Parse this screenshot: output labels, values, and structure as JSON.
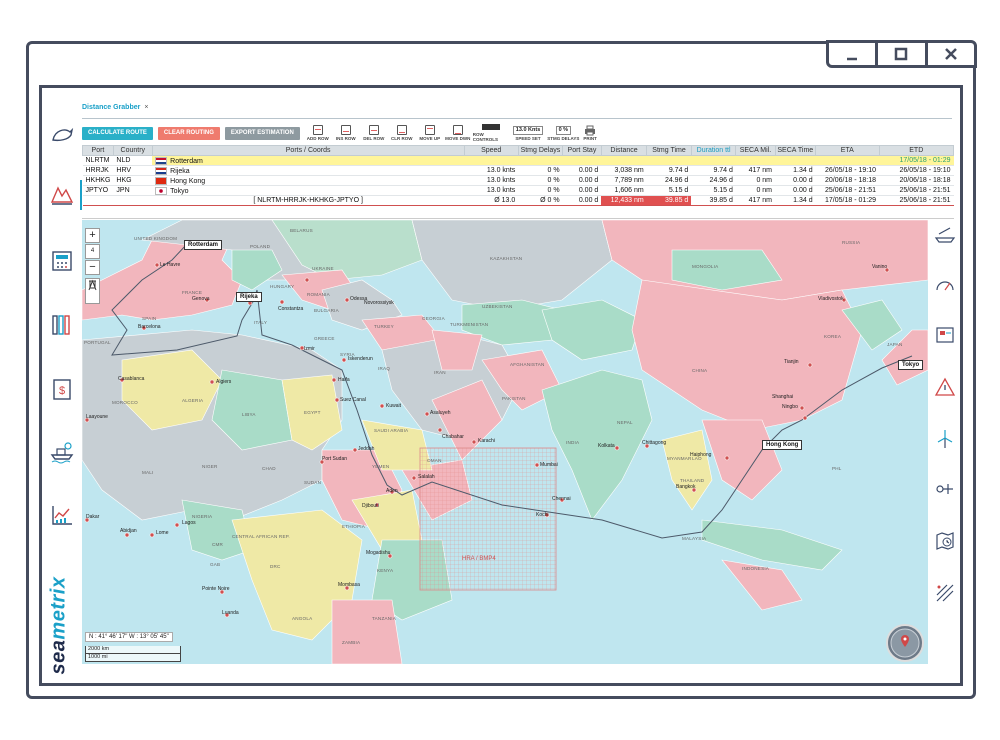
{
  "window": {
    "min_icon": "minimize-icon",
    "max_icon": "maximize-icon",
    "close_icon": "close-icon"
  },
  "tab": {
    "label": "Distance Grabber",
    "close": "×"
  },
  "toolbar": {
    "calculate": "CALCULATE ROUTE",
    "clear": "CLEAR ROUTING",
    "export": "EXPORT ESTIMATION",
    "icons": [
      "ADD ROW",
      "INS ROW",
      "DEL ROW",
      "CLR ROW",
      "MOVE UP",
      "MOVE DWN"
    ],
    "row_controls": "ROW CONTROLS",
    "speed_value": "13.0 Knts",
    "speed_label": "SPEED SET",
    "delays_value": "0 %",
    "delays_label": "STMG DELAYS",
    "print_label": "PRINT"
  },
  "table": {
    "headers": [
      "Port",
      "Country",
      "Ports / Coords",
      "Speed",
      "Stmg Delays",
      "Port Stay",
      "Distance",
      "Stmg Time",
      "Duration ttl",
      "SECA Mil.",
      "SECA Time",
      "ETA",
      "ETD"
    ],
    "rows": [
      {
        "port": "NLRTM",
        "country": "NLD",
        "name": "Rotterdam",
        "speed": "",
        "delays": "",
        "stay": "",
        "distance": "",
        "stmg": "",
        "duration": "",
        "seca": "",
        "secat": "",
        "eta": "",
        "etd": "17/05/18 - 01:29"
      },
      {
        "port": "HRRJK",
        "country": "HRV",
        "name": "Rijeka",
        "speed": "13.0 knts",
        "delays": "0 %",
        "stay": "0.00 d",
        "distance": "3,038 nm",
        "stmg": "9.74 d",
        "duration": "9.74 d",
        "seca": "417 nm",
        "secat": "1.34 d",
        "eta": "26/05/18 - 19:10",
        "etd": "26/05/18 - 19:10"
      },
      {
        "port": "HKHKG",
        "country": "HKG",
        "name": "Hong Kong",
        "speed": "13.0 knts",
        "delays": "0 %",
        "stay": "0.00 d",
        "distance": "7,789 nm",
        "stmg": "24.96 d",
        "duration": "24.96 d",
        "seca": "0 nm",
        "secat": "0.00 d",
        "eta": "20/06/18 - 18:18",
        "etd": "20/06/18 - 18:18"
      },
      {
        "port": "JPTYO",
        "country": "JPN",
        "name": "Tokyo",
        "speed": "13.0 knts",
        "delays": "0 %",
        "stay": "0.00 d",
        "distance": "1,606 nm",
        "stmg": "5.15 d",
        "duration": "5.15 d",
        "seca": "0 nm",
        "secat": "0.00 d",
        "eta": "25/06/18 - 21:51",
        "etd": "25/06/18 - 21:51"
      }
    ],
    "summary": {
      "route": "[ NLRTM-HRRJK-HKHKG-JPTYO ]",
      "speed": "Ø 13.0",
      "delays": "Ø 0 %",
      "stay": "0.00 d",
      "distance": "12,433 nm",
      "stmg": "39.85 d",
      "duration": "39.85 d",
      "seca": "417 nm",
      "secat": "1.34 d",
      "eta": "17/05/18 - 01:29",
      "etd": "25/06/18 - 21:51"
    }
  },
  "map": {
    "zoom_in": "+",
    "zoom_level": "4",
    "zoom_out": "−",
    "coords": "N : 41° 46' 17\"  W : 13° 05' 45\"",
    "scale_km": "2000 km",
    "scale_mi": "1000 mi",
    "hra": "HRA / BMP4",
    "port_labels": [
      "Rotterdam",
      "Rijeka",
      "Hong Kong",
      "Tokyo"
    ],
    "cities": [
      "Le Havre",
      "Genova",
      "Rijeka",
      "Odessa",
      "Novorossiysk",
      "Constantza",
      "Barcelona",
      "Izmir",
      "Iskenderun",
      "Haifa",
      "Suez Canal",
      "Algiers",
      "Casablanca",
      "Kuwait",
      "Asaluyeh",
      "Chabahar",
      "Karachi",
      "Jeddah",
      "Port Sudan",
      "Salalah",
      "Aden",
      "Djibouti",
      "Mumbai",
      "Kolkata",
      "Chittagong",
      "Chennai",
      "Kochi",
      "Haiphong",
      "Bangkok",
      "Shanghai",
      "Ningbo",
      "Tianjin",
      "Vladivostok",
      "Vanino",
      "Mogadishu",
      "Mombasa",
      "Lagos",
      "Abidjan",
      "Lome",
      "Pointe Noire",
      "Luanda",
      "Dakar",
      "Laayoune"
    ],
    "countries": [
      "UNITED KINGDOM",
      "POLAND",
      "BELARUS",
      "UKRAINE",
      "FRANCE",
      "ITALY",
      "SPAIN",
      "PORTUGAL",
      "HUNGARY",
      "ROMANIA",
      "BULGARIA",
      "GREECE",
      "TURKEY",
      "GEORGIA",
      "MOROCCO",
      "ALGERIA",
      "LIBYA",
      "EGYPT",
      "SAUDI ARABIA",
      "IRAQ",
      "IRAN",
      "SYRIA",
      "KAZAKHSTAN",
      "UZBEKISTAN",
      "TURKMENISTAN",
      "AFGHANISTAN",
      "PAKISTAN",
      "INDIA",
      "CHINA",
      "MONGOLIA",
      "RUSSIA",
      "KOREA",
      "JAPAN",
      "NEPAL",
      "MYANMAR",
      "THAILAND",
      "INDONESIA",
      "MALAYSIA",
      "MALI",
      "NIGER",
      "CHAD",
      "SUDAN",
      "ETHIOPIA",
      "YEMEN",
      "OMAN",
      "KENYA",
      "DRC",
      "ANGOLA",
      "NIGERIA",
      "CENTRAL AFRICAN REP.",
      "CMR",
      "GAB",
      "TANZANIA",
      "ZAMBIA",
      "LAO",
      "PHL"
    ]
  },
  "brand": {
    "a": "sea",
    "b": "metrix"
  }
}
